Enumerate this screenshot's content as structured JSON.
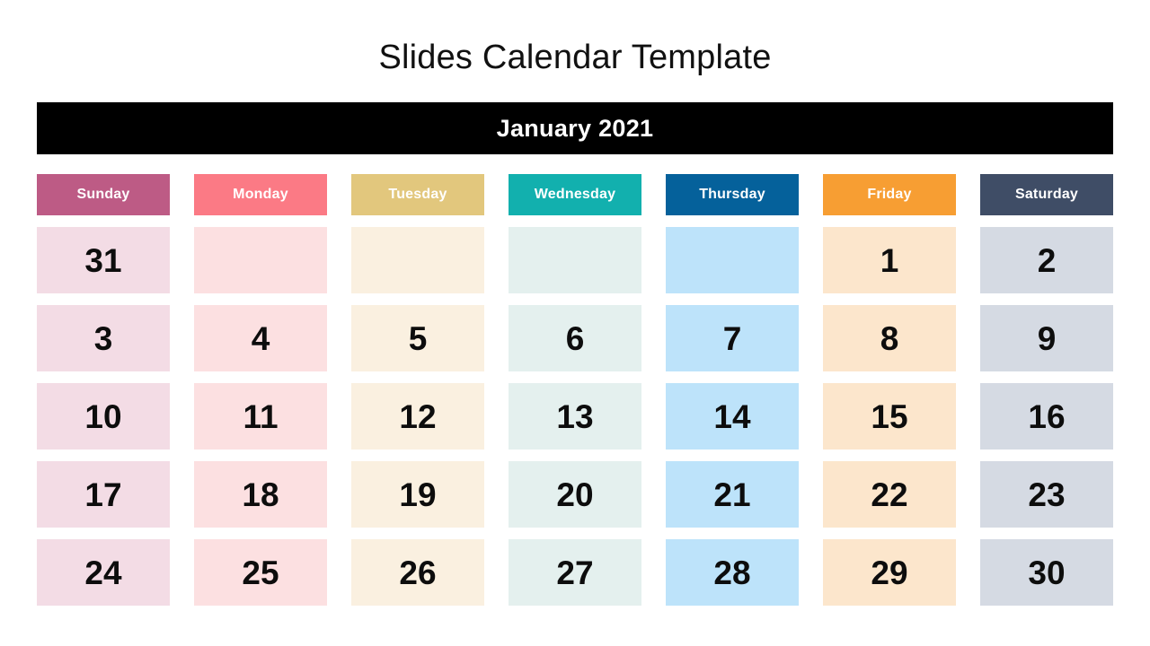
{
  "title": "Slides Calendar Template",
  "month_header": {
    "label": "January 2021",
    "background": "#000000",
    "text_color": "#ffffff"
  },
  "columns": [
    {
      "label": "Sunday",
      "header_color": "#BD5B85",
      "cell_color": "#F3DCE5"
    },
    {
      "label": "Monday",
      "header_color": "#FB7A85",
      "cell_color": "#FCE0E1"
    },
    {
      "label": "Tuesday",
      "header_color": "#E2C77D",
      "cell_color": "#FAF0E0"
    },
    {
      "label": "Wednesday",
      "header_color": "#12B0AE",
      "cell_color": "#E4F0EE"
    },
    {
      "label": "Thursday",
      "header_color": "#05619B",
      "cell_color": "#BDE3FA"
    },
    {
      "label": "Friday",
      "header_color": "#F79E33",
      "cell_color": "#FCE6CC"
    },
    {
      "label": "Saturday",
      "header_color": "#3F4D66",
      "cell_color": "#D5DAE3"
    }
  ],
  "weeks": [
    [
      {
        "day": "31",
        "empty": false
      },
      {
        "day": "",
        "empty": true
      },
      {
        "day": "",
        "empty": true
      },
      {
        "day": "",
        "empty": true
      },
      {
        "day": "",
        "empty": true
      },
      {
        "day": "1",
        "empty": false
      },
      {
        "day": "2",
        "empty": false
      }
    ],
    [
      {
        "day": "3",
        "empty": false
      },
      {
        "day": "4",
        "empty": false
      },
      {
        "day": "5",
        "empty": false
      },
      {
        "day": "6",
        "empty": false
      },
      {
        "day": "7",
        "empty": false
      },
      {
        "day": "8",
        "empty": false
      },
      {
        "day": "9",
        "empty": false
      }
    ],
    [
      {
        "day": "10",
        "empty": false
      },
      {
        "day": "11",
        "empty": false
      },
      {
        "day": "12",
        "empty": false
      },
      {
        "day": "13",
        "empty": false
      },
      {
        "day": "14",
        "empty": false
      },
      {
        "day": "15",
        "empty": false
      },
      {
        "day": "16",
        "empty": false
      }
    ],
    [
      {
        "day": "17",
        "empty": false
      },
      {
        "day": "18",
        "empty": false
      },
      {
        "day": "19",
        "empty": false
      },
      {
        "day": "20",
        "empty": false
      },
      {
        "day": "21",
        "empty": false
      },
      {
        "day": "22",
        "empty": false
      },
      {
        "day": "23",
        "empty": false
      }
    ],
    [
      {
        "day": "24",
        "empty": false
      },
      {
        "day": "25",
        "empty": false
      },
      {
        "day": "26",
        "empty": false
      },
      {
        "day": "27",
        "empty": false
      },
      {
        "day": "28",
        "empty": false
      },
      {
        "day": "29",
        "empty": false
      },
      {
        "day": "30",
        "empty": false
      }
    ]
  ]
}
